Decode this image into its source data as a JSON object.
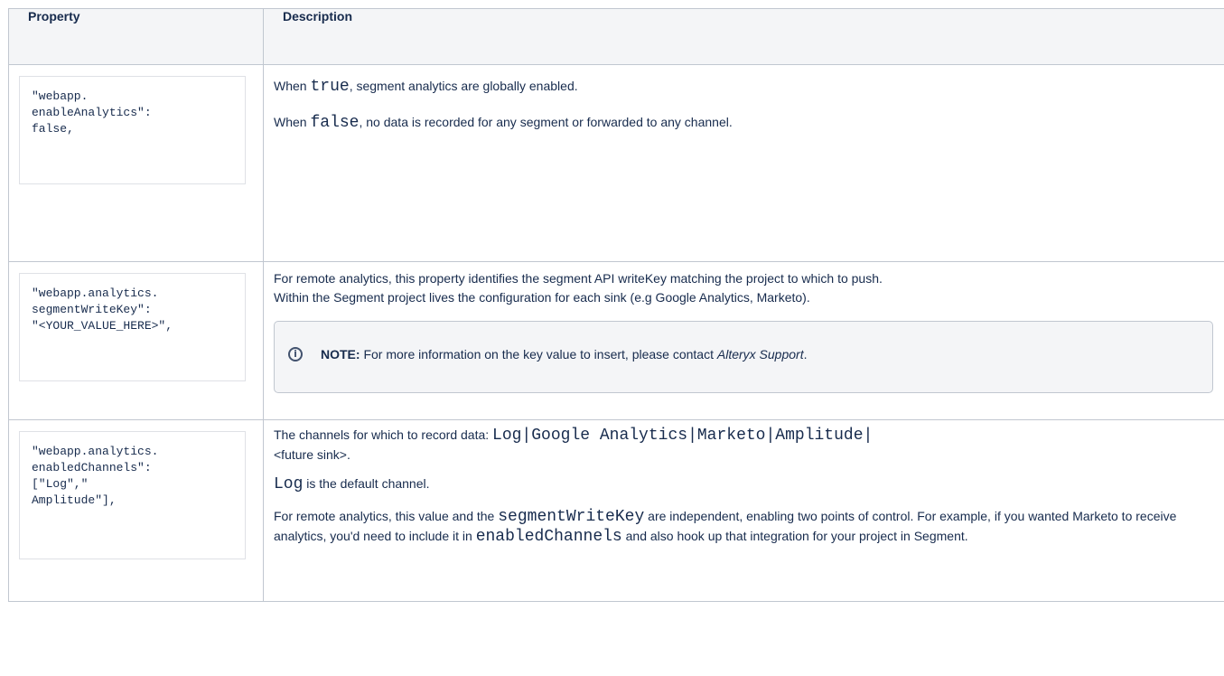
{
  "table": {
    "headers": {
      "property": "Property",
      "description": "Description"
    },
    "rows": [
      {
        "property_code": "\"webapp.\nenableAnalytics\":\nfalse,",
        "desc": {
          "p1_a": "When ",
          "p1_code": "true",
          "p1_b": ", segment analytics are globally enabled.",
          "p2_a": "When ",
          "p2_code": "false",
          "p2_b": ", no data is recorded for any segment or forwarded to any channel."
        }
      },
      {
        "property_code": "\"webapp.analytics.\nsegmentWriteKey\":\n\"<YOUR_VALUE_HERE>\",",
        "desc": {
          "p1_line1": "For remote analytics, this property identifies the segment API writeKey matching the project to which to push.",
          "p1_line2": "Within the Segment project lives the configuration for each sink (e.g Google Analytics, Marketo).",
          "note_label": "NOTE:",
          "note_text": " For more information on the key value to insert, please contact ",
          "note_em": "Alteryx Support",
          "note_end": ".",
          "note_icon": "info-icon"
        }
      },
      {
        "property_code": "\"webapp.analytics.\nenabledChannels\":\n[\"Log\",\"\nAmplitude\"],",
        "desc": {
          "p1_a": "The channels for which to record data: ",
          "p1_code": "Log|Google Analytics|Marketo|Amplitude|",
          "p1_b": "<future sink>.",
          "p2_code": "Log",
          "p2_b": " is the default channel.",
          "p3_a": "For remote analytics, this value and the ",
          "p3_code1": "segmentWriteKey",
          "p3_b": " are independent, enabling two points of control. For example, if you wanted Marketo to receive analytics, you'd need to include it in ",
          "p3_code2": "enabledChannels",
          "p3_c": " and also hook up that integration for your project in Segment."
        }
      }
    ]
  }
}
